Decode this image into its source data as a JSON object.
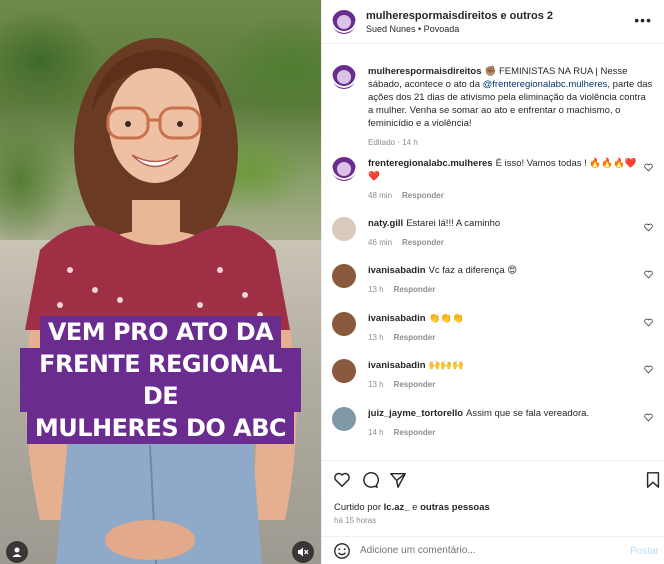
{
  "media": {
    "banner_lines": [
      "VEM PRO ATO DA",
      "FRENTE REGIONAL DE",
      "MULHERES DO ABC"
    ]
  },
  "header": {
    "title": "mulherespormaisdireitos e outros 2",
    "subtitle": "Sued Nunes • Povoada"
  },
  "caption": {
    "username": "mulherespormaisdireitos",
    "text_before": "✊🏽 FEMINISTAS NA RUA | Nesse sábado, acontece o ato da ",
    "mention": "@frenteregionalabc.mulheres",
    "text_after": ", parte das ações dos 21 dias de ativismo pela eliminação da violência contra a mulher. Venha se somar ao ato e enfrentar o machismo, o feminicídio e a violência!",
    "meta": "Editado · 14 h"
  },
  "comments": [
    {
      "username": "frenteregionalabc.mulheres",
      "text": "É isso! Vamos todas ! 🔥🔥🔥❤️ ❤️",
      "time": "48 min",
      "reply": "Responder"
    },
    {
      "username": "naty.gill",
      "text": "Estarei lá!!! A caminho",
      "time": "46 min",
      "reply": "Responder"
    },
    {
      "username": "ivanisabadin",
      "text": "Vc faz a diferença 😍",
      "time": "13 h",
      "reply": "Responder"
    },
    {
      "username": "ivanisabadin",
      "text": "👏👏👏",
      "time": "13 h",
      "reply": "Responder"
    },
    {
      "username": "ivanisabadin",
      "text": "🙌🙌🙌",
      "time": "13 h",
      "reply": "Responder"
    },
    {
      "username": "juiz_jayme_tortorello",
      "text": "Assim que se fala vereadora.",
      "time": "14 h",
      "reply": "Responder"
    }
  ],
  "actions": {
    "liked_prefix": "Curtido por ",
    "liked_user": "lc.az_",
    "liked_suffix": " e ",
    "liked_others": "outras pessoas",
    "time_ago": "há 15 horas"
  },
  "composer": {
    "placeholder": "Adicione um comentário...",
    "post_label": "Postar"
  },
  "colors": {
    "brand_purple": "#6a2d8f",
    "link": "#00376b",
    "muted": "#8e8e8e",
    "post_disabled": "#b2dffc"
  }
}
